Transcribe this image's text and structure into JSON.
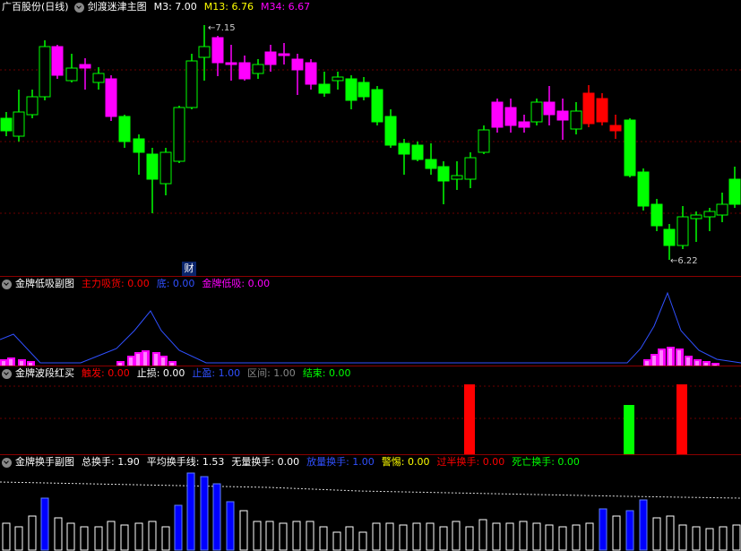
{
  "main": {
    "stock_title": "广百股份(日线)",
    "indicator_name": "剑渡迷津主图",
    "m3_label": "M3: 7.00",
    "m13_label": "M13: 6.76",
    "m34_label": "M34: 6.67",
    "high_mark": "7.15",
    "low_mark": "6.22",
    "cai_badge": "财",
    "colors": {
      "up_green": "#00ff00",
      "down_magenta": "#ff00ff",
      "red": "#ff0000",
      "m3": "#ffffff",
      "m13": "#ffff00",
      "m34": "#ff00ff"
    }
  },
  "panel2": {
    "name": "金牌低吸副图",
    "zhuli": "主力吸货: 0.00",
    "di": "底: 0.00",
    "dixi": "金牌低吸: 0.00"
  },
  "panel3": {
    "name": "金牌波段红买",
    "chufa": "触发: 0.00",
    "zhisun": "止损: 0.00",
    "zhiying": "止盈: 1.00",
    "qujian": "区间: 1.00",
    "jieshu": "结束: 0.00"
  },
  "panel4": {
    "name": "金牌换手副图",
    "zong": "总换手: 1.90",
    "pingjun": "平均换手线: 1.53",
    "wuliang": "无量换手: 0.00",
    "fangliang": "放量换手: 1.00",
    "jingti": "警惕: 0.00",
    "guoban": "过半换手: 0.00",
    "siwang": "死亡换手: 0.00"
  }
}
